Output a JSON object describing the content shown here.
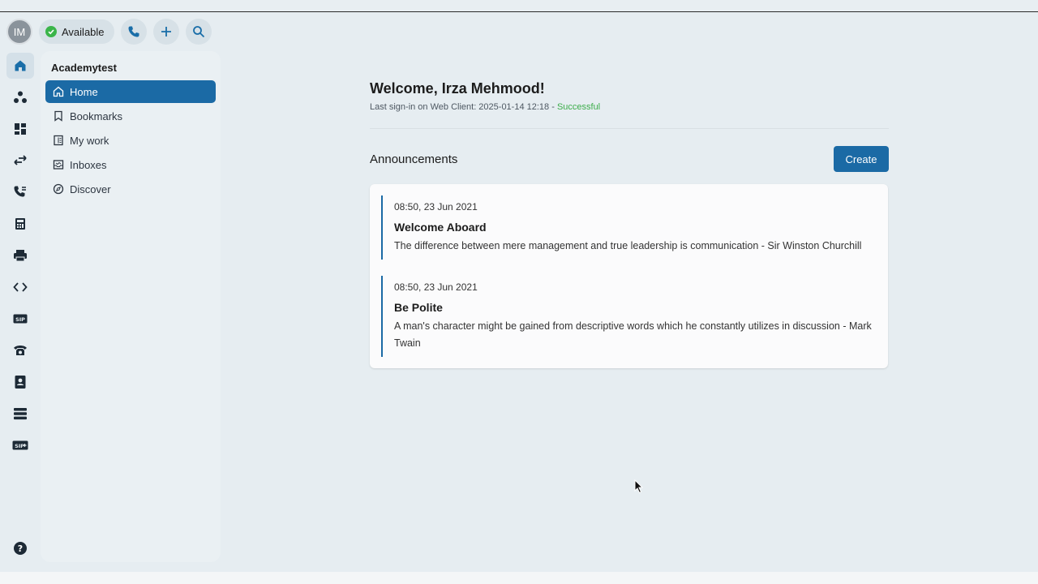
{
  "topbar": {
    "avatar_initials": "IM",
    "status_label": "Available",
    "status_color": "#3bb54a",
    "buttons": [
      "phone-icon",
      "plus-icon",
      "search-icon"
    ]
  },
  "rail": {
    "icons": [
      "home-icon",
      "team-icon",
      "dashboard-icon",
      "transfer-icon",
      "call-log-icon",
      "calculator-icon",
      "printer-icon",
      "code-icon",
      "sip-icon",
      "telephone-icon",
      "contacts-icon",
      "list-icon",
      "sip-plus-icon",
      "help-icon"
    ],
    "active": "home-icon"
  },
  "nav": {
    "title": "Academytest",
    "items": [
      {
        "label": "Home",
        "icon": "home-icon",
        "active": true
      },
      {
        "label": "Bookmarks",
        "icon": "bookmark-icon"
      },
      {
        "label": "My work",
        "icon": "document-icon"
      },
      {
        "label": "Inboxes",
        "icon": "inbox-icon"
      },
      {
        "label": "Discover",
        "icon": "compass-icon"
      }
    ]
  },
  "main": {
    "welcome": "Welcome, Irza Mehmood!",
    "signin_prefix": "Last sign-in on Web Client: 2025-01-14 12:18 - ",
    "signin_status": "Successful",
    "announcements_title": "Announcements",
    "create_label": "Create",
    "accent_color": "#1b6aa5",
    "announcements": [
      {
        "time": "08:50, 23 Jun 2021",
        "subject": "Welcome Aboard",
        "body": "The difference between mere management and true leadership is communication - Sir Winston Churchill"
      },
      {
        "time": "08:50, 23 Jun 2021",
        "subject": "Be Polite",
        "body": "A man's character might be gained from descriptive words which he constantly utilizes in discussion - Mark Twain"
      }
    ]
  }
}
